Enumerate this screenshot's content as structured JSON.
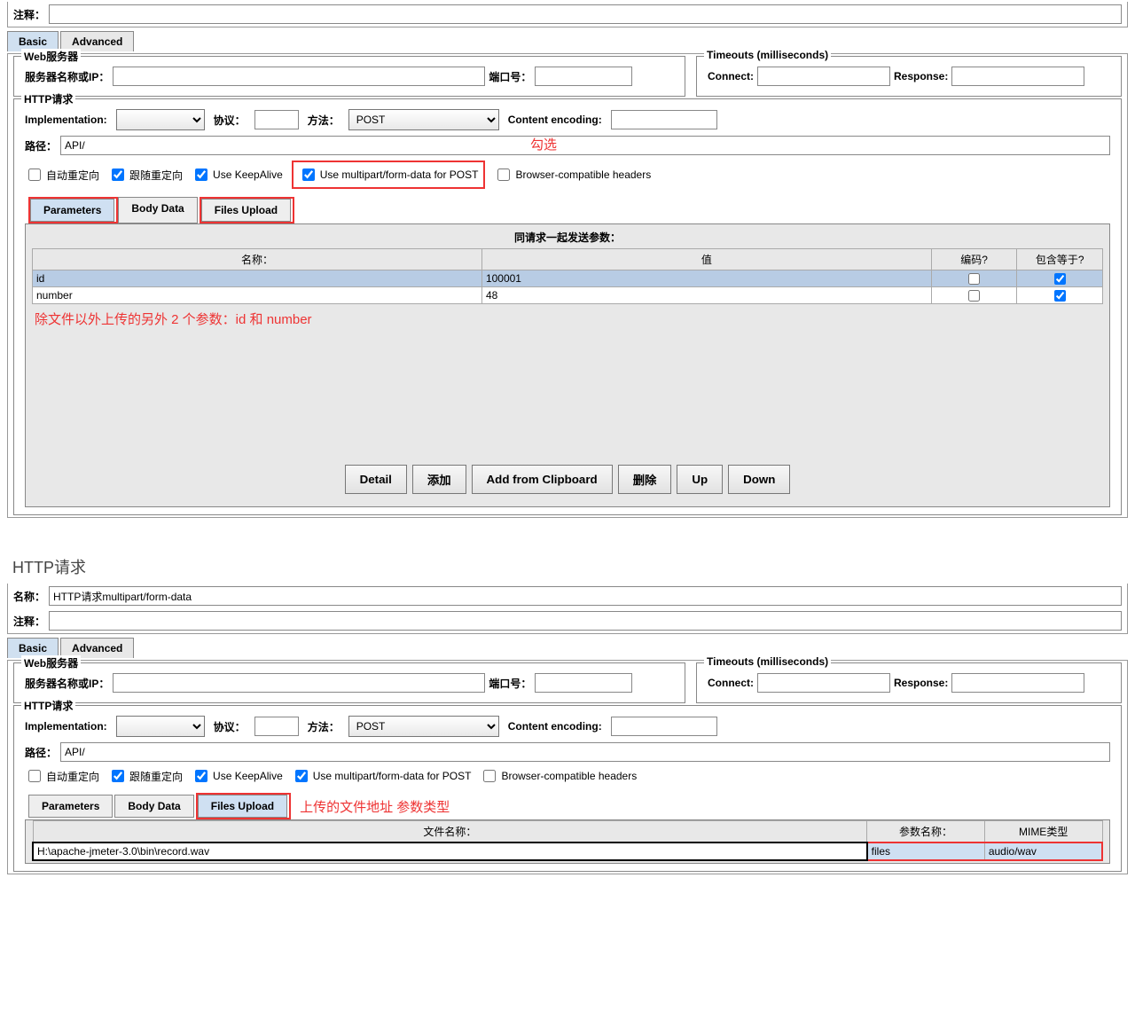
{
  "top": {
    "comment_label": "注释：",
    "tabs": {
      "basic": "Basic",
      "advanced": "Advanced"
    },
    "active_tab": "basic",
    "webserver": {
      "legend": "Web服务器",
      "server_label": "服务器名称或IP：",
      "server_value": "",
      "port_label": "端口号：",
      "port_value": ""
    },
    "timeouts": {
      "legend": "Timeouts (milliseconds)",
      "connect_label": "Connect:",
      "connect_value": "",
      "response_label": "Response:",
      "response_value": ""
    },
    "http": {
      "legend": "HTTP请求",
      "impl_label": "Implementation:",
      "impl_value": "",
      "protocol_label": "协议：",
      "protocol_value": "",
      "method_label": "方法：",
      "method_value": "POST",
      "encoding_label": "Content encoding:",
      "encoding_value": "",
      "path_label": "路径：",
      "path_value": "API/",
      "cb_autoredirect": "自动重定向",
      "cb_followredirect": "跟随重定向",
      "cb_keepalive": "Use KeepAlive",
      "cb_multipart": "Use multipart/form-data for POST",
      "cb_browser": "Browser-compatible headers",
      "annotation_check": "勾选"
    },
    "subtabs": {
      "parameters": "Parameters",
      "bodydata": "Body Data",
      "filesupload": "Files Upload"
    },
    "active_subtab": "parameters",
    "params_table": {
      "title": "同请求一起发送参数：",
      "col_name": "名称：",
      "col_value": "值",
      "col_encode": "编码?",
      "col_include": "包含等于?",
      "rows": [
        {
          "name": "id",
          "value": "100001",
          "encode": false,
          "include": true
        },
        {
          "name": "number",
          "value": "48",
          "encode": false,
          "include": true
        }
      ],
      "annotation": "除文件以外上传的另外 2 个参数：id 和 number"
    },
    "buttons": {
      "detail": "Detail",
      "add": "添加",
      "addclip": "Add from Clipboard",
      "delete": "删除",
      "up": "Up",
      "down": "Down"
    }
  },
  "bottom": {
    "section_title": "HTTP请求",
    "name_label": "名称：",
    "name_value": "HTTP请求multipart/form-data",
    "comment_label": "注释：",
    "tabs": {
      "basic": "Basic",
      "advanced": "Advanced"
    },
    "active_tab": "basic",
    "webserver": {
      "legend": "Web服务器",
      "server_label": "服务器名称或IP：",
      "server_value": "",
      "port_label": "端口号：",
      "port_value": ""
    },
    "timeouts": {
      "legend": "Timeouts (milliseconds)",
      "connect_label": "Connect:",
      "connect_value": "",
      "response_label": "Response:",
      "response_value": ""
    },
    "http": {
      "legend": "HTTP请求",
      "impl_label": "Implementation:",
      "impl_value": "",
      "protocol_label": "协议：",
      "protocol_value": "",
      "method_label": "方法：",
      "method_value": "POST",
      "encoding_label": "Content encoding:",
      "encoding_value": "",
      "path_label": "路径：",
      "path_value": "API/",
      "cb_autoredirect": "自动重定向",
      "cb_followredirect": "跟随重定向",
      "cb_keepalive": "Use KeepAlive",
      "cb_multipart": "Use multipart/form-data for POST",
      "cb_browser": "Browser-compatible headers"
    },
    "subtabs": {
      "parameters": "Parameters",
      "bodydata": "Body Data",
      "filesupload": "Files Upload"
    },
    "active_subtab": "filesupload",
    "annotation_files": "上传的文件地址 参数类型",
    "files_table": {
      "col_path": "文件名称：",
      "col_param": "参数名称：",
      "col_mime": "MIME类型",
      "rows": [
        {
          "path": "H:\\apache-jmeter-3.0\\bin\\record.wav",
          "param": "files",
          "mime": "audio/wav"
        }
      ]
    }
  }
}
